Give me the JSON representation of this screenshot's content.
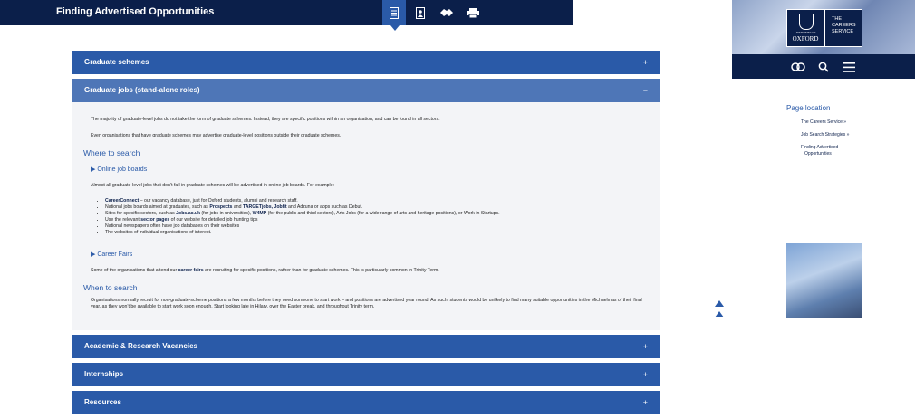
{
  "header": {
    "title": "Finding Advertised Opportunities",
    "icons": [
      "document-icon",
      "user-profile-icon",
      "handshake-icon",
      "print-icon"
    ]
  },
  "accordion": [
    {
      "label": "Graduate schemes",
      "sign": "+"
    },
    {
      "label": "Graduate jobs (stand-alone roles)",
      "sign": "−"
    },
    {
      "label": "Academic & Research Vacancies",
      "sign": "+"
    },
    {
      "label": "Internships",
      "sign": "+"
    },
    {
      "label": "Resources",
      "sign": "+"
    }
  ],
  "panel": {
    "p1": "The majority of graduate-level jobs do not take the form of graduate schemes. Instead, they are specific positions within an organisation, and can be found in all sectors.",
    "p2": "Even organisations that have graduate schemes may advertise graduate-level positions outside their graduate schemes.",
    "h_where": "Where to search",
    "h_online": "▶ Online job boards",
    "p3": "Almost all graduate-level jobs that don’t fall in graduate schemes will be advertised in online job boards. For example:",
    "list": [
      {
        "pre": "",
        "b1": "CareerConnect",
        "mid": " – our vacancy database, just for Oxford students, alumni and research staff.",
        "b2": "",
        "post": ""
      },
      {
        "pre": "National jobs boards aimed at graduates, such as ",
        "b1": "Prospects",
        "mid": " and ",
        "b2": "TARGETjobs, Jobfit",
        "post": " and Adzuna or apps such as Debut."
      },
      {
        "pre": "Sites for specific sectors, such as ",
        "b1": "Jobs.ac.uk",
        "mid": " (for jobs in universities), ",
        "b2": "W4MP",
        "post": " (for the public and third sectors), Arts Jobs (for a wide range of arts and heritage positions), or Work in Startups."
      },
      {
        "pre": "Use the relevant ",
        "b1": "sector pages",
        "mid": " of our website for detailed job hunting tips",
        "b2": "",
        "post": ""
      },
      {
        "pre": "National newspapers often have job databases on their websites",
        "b1": "",
        "mid": "",
        "b2": "",
        "post": ""
      },
      {
        "pre": "The websites of individual organisations of interest.",
        "b1": "",
        "mid": "",
        "b2": "",
        "post": ""
      }
    ],
    "h_fairs": "▶ Career Fairs",
    "p4_pre": "Some of the organisations that attend our ",
    "p4_b": "career fairs",
    "p4_post": " are recruiting for specific positions, rather than for graduate schemes. This is particularly common in Trinity Term.",
    "h_when": "When to search",
    "p5": "Organisations normally recruit for non-graduate-scheme positions a few months before they need someone to start work – and positions are advertised year round. As such, students would be unlikely to find many suitable opportunities in the Michaelmas of their final year, as they won’t be available to start work soon enough. Start looking late in Hilary, over the Easter break, and throughout Trinity term."
  },
  "logo": {
    "uni_small": "UNIVERSITY OF",
    "uni": "OXFORD",
    "careers": [
      "THE",
      "CAREERS",
      "SERVICE"
    ]
  },
  "sidebar": {
    "title": "Page location",
    "crumbs": [
      "The Careers Service »",
      "Job Search Strategies »",
      "Finding Advertised",
      "Opportunities"
    ]
  },
  "colors": {
    "navy": "#0b1f4a",
    "blue": "#2a5aa8"
  }
}
